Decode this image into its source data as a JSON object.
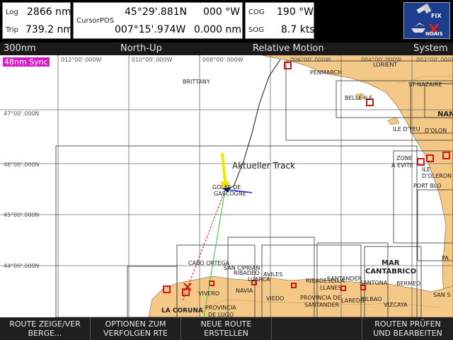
{
  "status": {
    "log_label": "Log",
    "log_value": "2866 nm",
    "trip_label": "Trip",
    "trip_value": "739.2 nm",
    "cursor_label": "CursorPOS",
    "lat": "45°29'.881N",
    "lon": "007°15'.974W",
    "bearing": "000 °W",
    "distance": "0.000 nm",
    "cog_label": "COG",
    "cog_value": "190 °W",
    "sog_label": "SOG",
    "sog_value": "8.7 kts",
    "badge_fix": "FIX",
    "badge_noais": "NOAIS"
  },
  "chart_bar": {
    "range": "300nm",
    "orientation": "North-Up",
    "motion": "Relative Motion",
    "menu": "System",
    "sync": "48nm Sync"
  },
  "chart": {
    "lon_labels": [
      "012°00'.000W",
      "010°00'.000W",
      "008°00'.000W",
      "006°00'.000W",
      "004°00'.000W",
      "002°00'.000W"
    ],
    "lat_labels": [
      "47°00'.000N",
      "46°00'.000N",
      "45°00'.000N",
      "44°00'.000N"
    ],
    "track_label": "Aktueller Track",
    "places": {
      "brittany": "BRITTANY",
      "penmarch": "PENMARCH",
      "lorient": "LORIENT",
      "belle_ile": "BELLE-ILE",
      "st_nazaire": "ST-NAZAIRE",
      "nan": "NAN",
      "ile_dyeu": "ILE D'YEU",
      "olon": "D'OLON",
      "zone": "ZONE",
      "a_evite": "A EVITE",
      "ile_doleron": "ILE D'OLERON",
      "port_blo": "PORT BLO",
      "golfe": "GOLFE DE",
      "gascogne": "GASCOGNE",
      "cabo_ortega": "CABO ORTEGA",
      "san_ciprian": "SAN CIPRIAN",
      "ribadeo": "RIBADEO",
      "aviles": "AVILES",
      "luarca": "LUARCA",
      "santander": "SANTANDER",
      "mar": "MAR",
      "cantabrico": "CANTABRICO",
      "ribadesella": "RIBADESELLA",
      "llanes": "LLANES",
      "santona": "SANTONA",
      "bermeo": "BERMEO",
      "vivero": "VIVERO",
      "navia": "NAVIA",
      "viedo": "VIEDO",
      "prov_santander_1": "PROVINCIA DE",
      "prov_santander_2": "SANTANDER",
      "laredo": "LAREDO",
      "bilbao": "BILBAO",
      "vizcaya": "VIZCAYA",
      "la_coruna": "LA CORUNA",
      "provincia": "PROVINCIA",
      "de_lugo": "DE LUGO",
      "pa": "PA",
      "san_s": "SAN S"
    }
  },
  "softkeys": [
    {
      "line1": "ROUTE ZEIGE/VER",
      "line2": "BERGE..."
    },
    {
      "line1": "OPTIONEN ZUM",
      "line2": "VERFOLGEN RTE"
    },
    {
      "line1": "NEUE ROUTE",
      "line2": "ERSTELLEN"
    },
    {
      "line1": "",
      "line2": ""
    },
    {
      "line1": "ROUTEN PRÜFEN",
      "line2": "UND BEARBEITEN"
    }
  ]
}
